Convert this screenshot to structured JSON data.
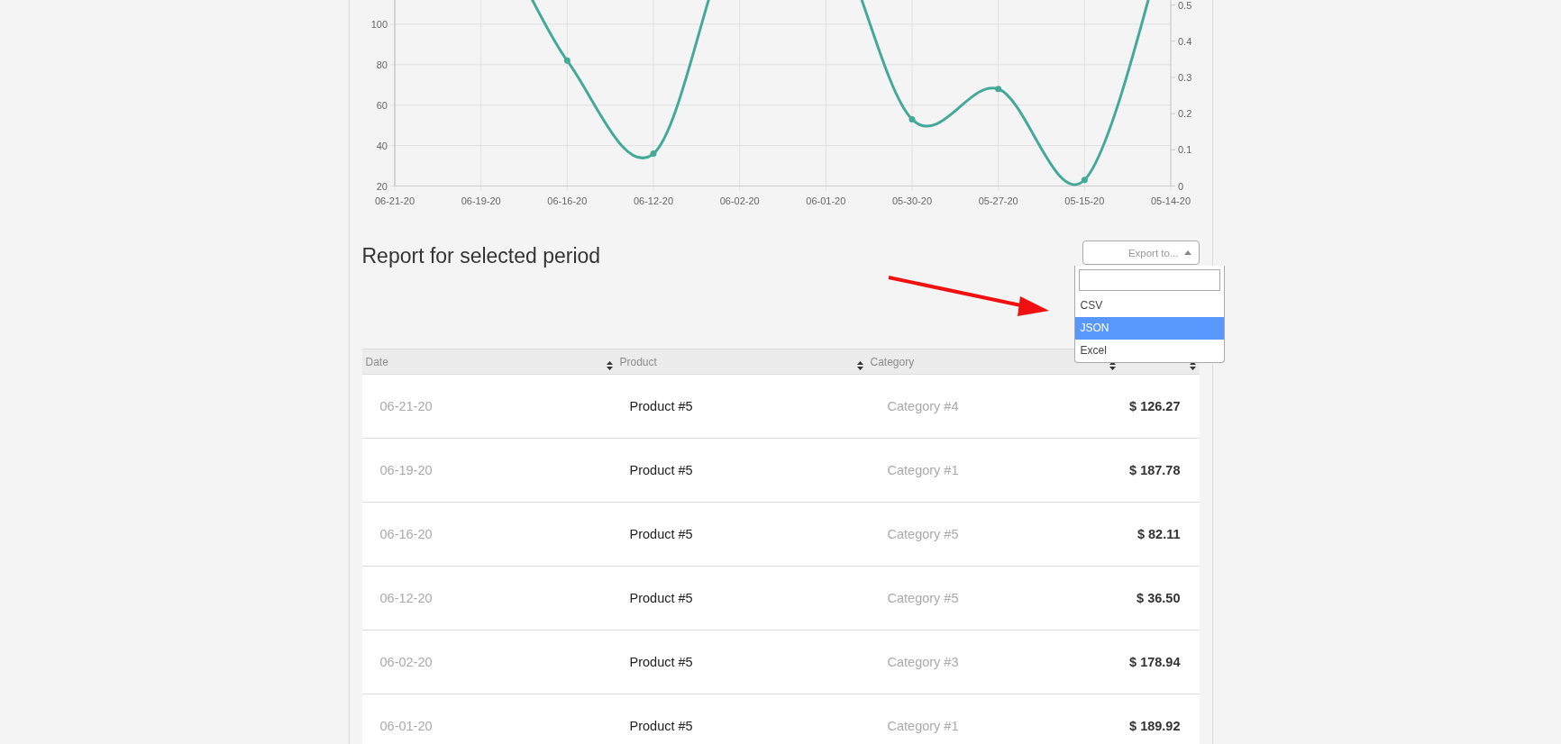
{
  "chart": {
    "chart_data": {
      "type": "line",
      "categories": [
        "06-21-20",
        "06-19-20",
        "06-16-20",
        "06-12-20",
        "06-02-20",
        "06-01-20",
        "05-30-20",
        "05-27-20",
        "05-15-20",
        "05-14-20"
      ],
      "series": [
        {
          "color": "#45a99a",
          "marker": true,
          "values": [
            null,
            null,
            82,
            36,
            null,
            null,
            53,
            68,
            23,
            null
          ]
        }
      ],
      "ylim": [
        20,
        112
      ],
      "yticks": [
        20,
        40,
        60,
        80,
        100
      ],
      "y2lim": [
        0,
        0.514
      ],
      "y2ticks": [
        0,
        0.1,
        0.2,
        0.3,
        0.4,
        0.5
      ],
      "grid": true
    }
  },
  "report": {
    "title": "Report for selected period",
    "export": {
      "placeholder": "Export to...",
      "expanded": true,
      "options": [
        {
          "label": "CSV",
          "selected": false
        },
        {
          "label": "JSON",
          "selected": true
        },
        {
          "label": "Excel",
          "selected": false
        }
      ]
    }
  },
  "table": {
    "columns": [
      {
        "label": "Date",
        "sortable": true
      },
      {
        "label": "Product",
        "sortable": true
      },
      {
        "label": "Category",
        "sortable": true
      },
      {
        "sortable": true
      }
    ],
    "rows": [
      {
        "date": "06-21-20",
        "product": "Product #5",
        "category": "Category #4",
        "expense": "$ 126.27"
      },
      {
        "date": "06-19-20",
        "product": "Product #5",
        "category": "Category #1",
        "expense": "$ 187.78"
      },
      {
        "date": "06-16-20",
        "product": "Product #5",
        "category": "Category #5",
        "expense": "$ 82.11"
      },
      {
        "date": "06-12-20",
        "product": "Product #5",
        "category": "Category #5",
        "expense": "$ 36.50"
      },
      {
        "date": "06-02-20",
        "product": "Product #5",
        "category": "Category #3",
        "expense": "$ 178.94"
      },
      {
        "date": "06-01-20",
        "product": "Product #5",
        "category": "Category #1",
        "expense": "$ 189.92"
      }
    ]
  }
}
